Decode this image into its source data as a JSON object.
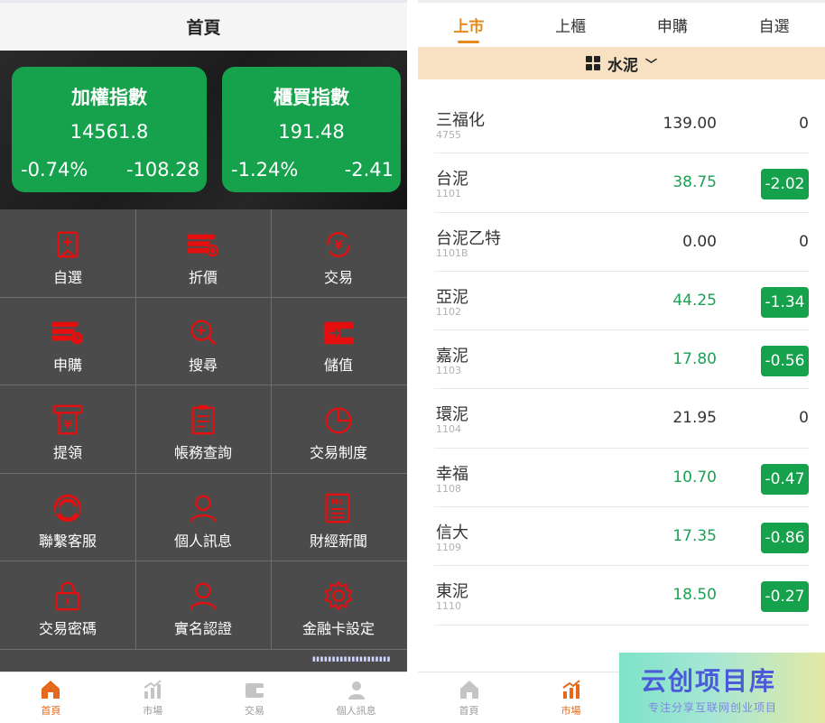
{
  "left": {
    "header_title": "首頁",
    "cards": [
      {
        "name": "加權指數",
        "value": "14561.8",
        "pct": "-0.74%",
        "change": "-108.28"
      },
      {
        "name": "櫃買指數",
        "value": "191.48",
        "pct": "-1.24%",
        "change": "-2.41"
      }
    ],
    "menu": [
      {
        "label": "自選",
        "icon": "bookmark-icon"
      },
      {
        "label": "折價",
        "icon": "discount-icon"
      },
      {
        "label": "交易",
        "icon": "yen-cycle-icon"
      },
      {
        "label": "申購",
        "icon": "subscribe-icon"
      },
      {
        "label": "搜尋",
        "icon": "search-icon"
      },
      {
        "label": "儲值",
        "icon": "wallet-icon"
      },
      {
        "label": "提領",
        "icon": "withdraw-icon"
      },
      {
        "label": "帳務查詢",
        "icon": "ledger-icon"
      },
      {
        "label": "交易制度",
        "icon": "pie-icon"
      },
      {
        "label": "聯繫客服",
        "icon": "headset-icon"
      },
      {
        "label": "個人訊息",
        "icon": "user-icon"
      },
      {
        "label": "財經新聞",
        "icon": "news-icon"
      },
      {
        "label": "交易密碼",
        "icon": "lock-icon"
      },
      {
        "label": "實名認證",
        "icon": "verify-user-icon"
      },
      {
        "label": "金融卡設定",
        "icon": "gear-icon"
      }
    ],
    "tabbar": [
      {
        "label": "首頁",
        "icon": "home-icon",
        "active": true
      },
      {
        "label": "市場",
        "icon": "chart-icon",
        "active": false
      },
      {
        "label": "交易",
        "icon": "wallet-icon",
        "active": false
      },
      {
        "label": "個人訊息",
        "icon": "user-icon",
        "active": false
      }
    ],
    "accent_color": "#e50f0f",
    "card_color": "#16a24c"
  },
  "right": {
    "tabs": [
      {
        "label": "上市",
        "active": true
      },
      {
        "label": "上櫃",
        "active": false
      },
      {
        "label": "申購",
        "active": false
      },
      {
        "label": "自選",
        "active": false
      }
    ],
    "category": "水泥",
    "stocks": [
      {
        "name": "三福化",
        "code": "4755",
        "price": "139.00",
        "change": "0",
        "green": false
      },
      {
        "name": "台泥",
        "code": "1101",
        "price": "38.75",
        "change": "-2.02",
        "green": true
      },
      {
        "name": "台泥乙特",
        "code": "1101B",
        "price": "0.00",
        "change": "0",
        "green": false
      },
      {
        "name": "亞泥",
        "code": "1102",
        "price": "44.25",
        "change": "-1.34",
        "green": true
      },
      {
        "name": "嘉泥",
        "code": "1103",
        "price": "17.80",
        "change": "-0.56",
        "green": true
      },
      {
        "name": "環泥",
        "code": "1104",
        "price": "21.95",
        "change": "0",
        "green": false
      },
      {
        "name": "幸福",
        "code": "1108",
        "price": "10.70",
        "change": "-0.47",
        "green": true
      },
      {
        "name": "信大",
        "code": "1109",
        "price": "17.35",
        "change": "-0.86",
        "green": true
      },
      {
        "name": "東泥",
        "code": "1110",
        "price": "18.50",
        "change": "-0.27",
        "green": true
      }
    ],
    "tabbar": [
      {
        "label": "首頁",
        "icon": "home-icon",
        "active": false
      },
      {
        "label": "市場",
        "icon": "chart-icon",
        "active": true
      }
    ],
    "watermark_title": "云创项目库",
    "watermark_sub": "专注分享互联网创业项目",
    "active_tab_color": "#e78a1e",
    "category_bg": "#f8e0c3"
  }
}
